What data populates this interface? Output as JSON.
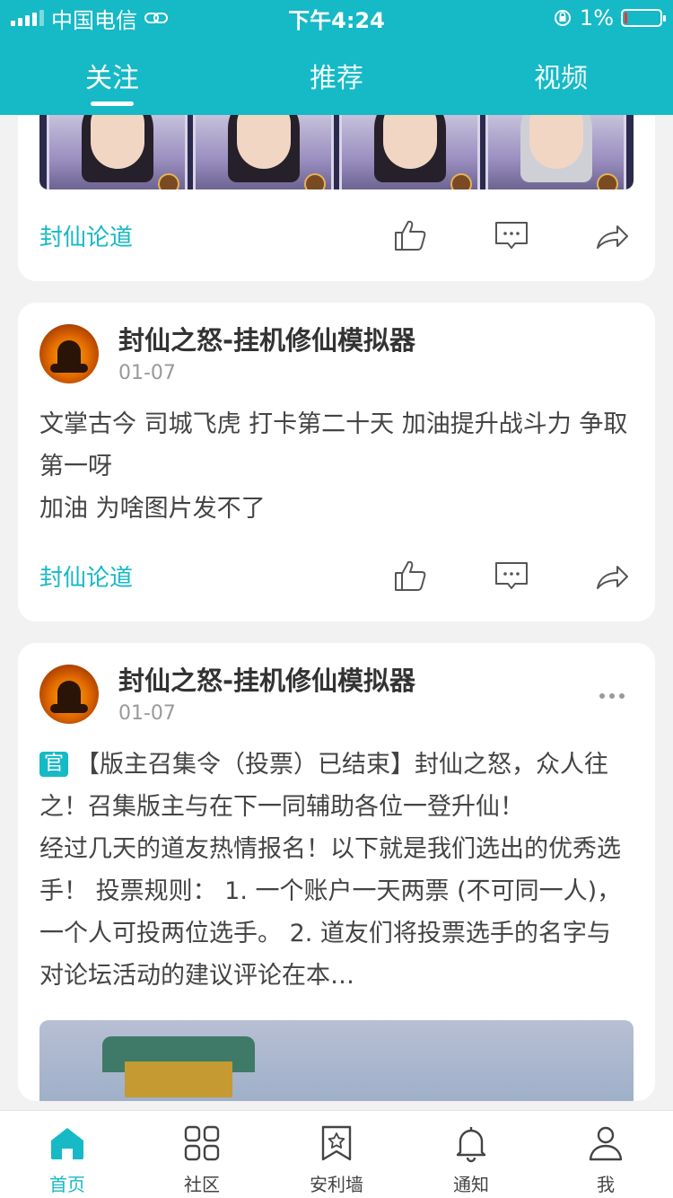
{
  "status_bar": {
    "carrier": "中国电信",
    "time": "下午4:24",
    "battery": "1%"
  },
  "tabs": [
    {
      "label": "关注",
      "active": true
    },
    {
      "label": "推荐",
      "active": false
    },
    {
      "label": "视频",
      "active": false
    }
  ],
  "posts": [
    {
      "tag": "封仙论道"
    },
    {
      "author": "封仙之怒-挂机修仙模拟器",
      "date": "01-07",
      "content_lines": [
        "文掌古今 司城飞虎 打卡第二十天 加油提升战斗力 争取第一呀",
        "加油 为啥图片发不了"
      ],
      "tag": "封仙论道"
    },
    {
      "author": "封仙之怒-挂机修仙模拟器",
      "date": "01-07",
      "official_badge": "官",
      "content_lines": [
        "【版主召集令（投票）已结束】封仙之怒，众人往之！召集版主与在下一同辅助各位一登升仙！",
        "经过几天的道友热情报名！以下就是我们选出的优秀选手！    投票规则： 1. 一个账户一天两票 (不可同一人)，一个人可投两位选手。 2. 道友们将投票选手的名字与对论坛活动的建议评论在本…"
      ]
    }
  ],
  "tabbar": [
    {
      "label": "首页",
      "icon": "home-icon",
      "active": true
    },
    {
      "label": "社区",
      "icon": "grid-icon",
      "active": false
    },
    {
      "label": "安利墙",
      "icon": "bookmark-star-icon",
      "active": false
    },
    {
      "label": "通知",
      "icon": "bell-icon",
      "active": false
    },
    {
      "label": "我",
      "icon": "user-icon",
      "active": false
    }
  ],
  "colors": {
    "accent": "#16b9c6",
    "background": "#f2f2f2"
  }
}
